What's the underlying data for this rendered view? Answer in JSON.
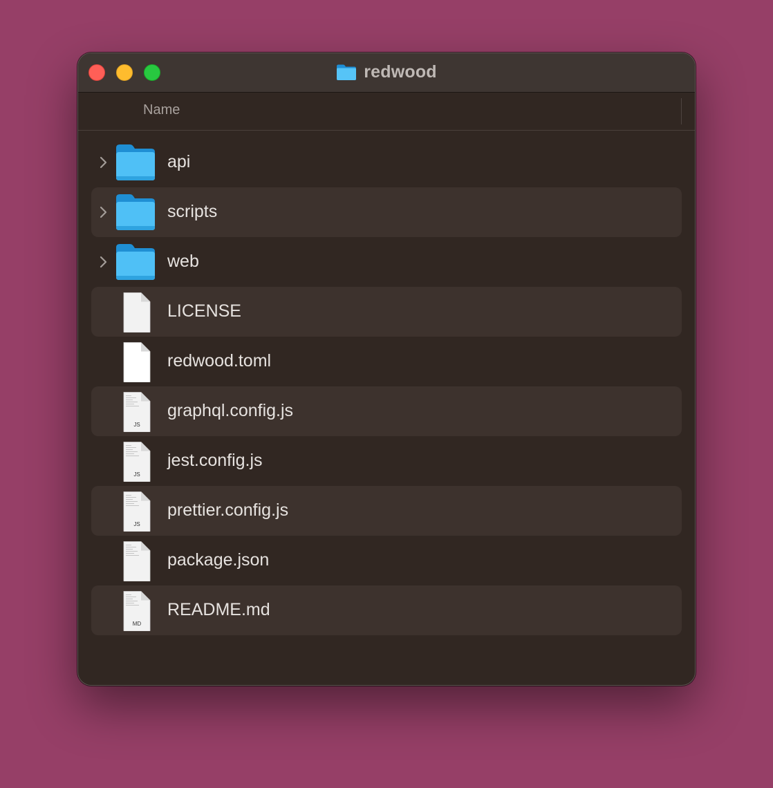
{
  "window": {
    "title": "redwood",
    "title_icon": "folder-icon"
  },
  "header": {
    "name_column": "Name"
  },
  "colors": {
    "desktop": "#963f67",
    "window_bg": "#312722",
    "row_alt": "#3d322d",
    "folder_blue": "#4bbdf5"
  },
  "items": [
    {
      "name": "api",
      "kind": "folder",
      "expandable": true
    },
    {
      "name": "scripts",
      "kind": "folder",
      "expandable": true
    },
    {
      "name": "web",
      "kind": "folder",
      "expandable": true
    },
    {
      "name": "LICENSE",
      "kind": "document"
    },
    {
      "name": "redwood.toml",
      "kind": "blank"
    },
    {
      "name": "graphql.config.js",
      "kind": "code",
      "badge": "JS"
    },
    {
      "name": "jest.config.js",
      "kind": "code",
      "badge": "JS"
    },
    {
      "name": "prettier.config.js",
      "kind": "code",
      "badge": "JS"
    },
    {
      "name": "package.json",
      "kind": "code",
      "badge": ""
    },
    {
      "name": "README.md",
      "kind": "code",
      "badge": "MD"
    }
  ]
}
